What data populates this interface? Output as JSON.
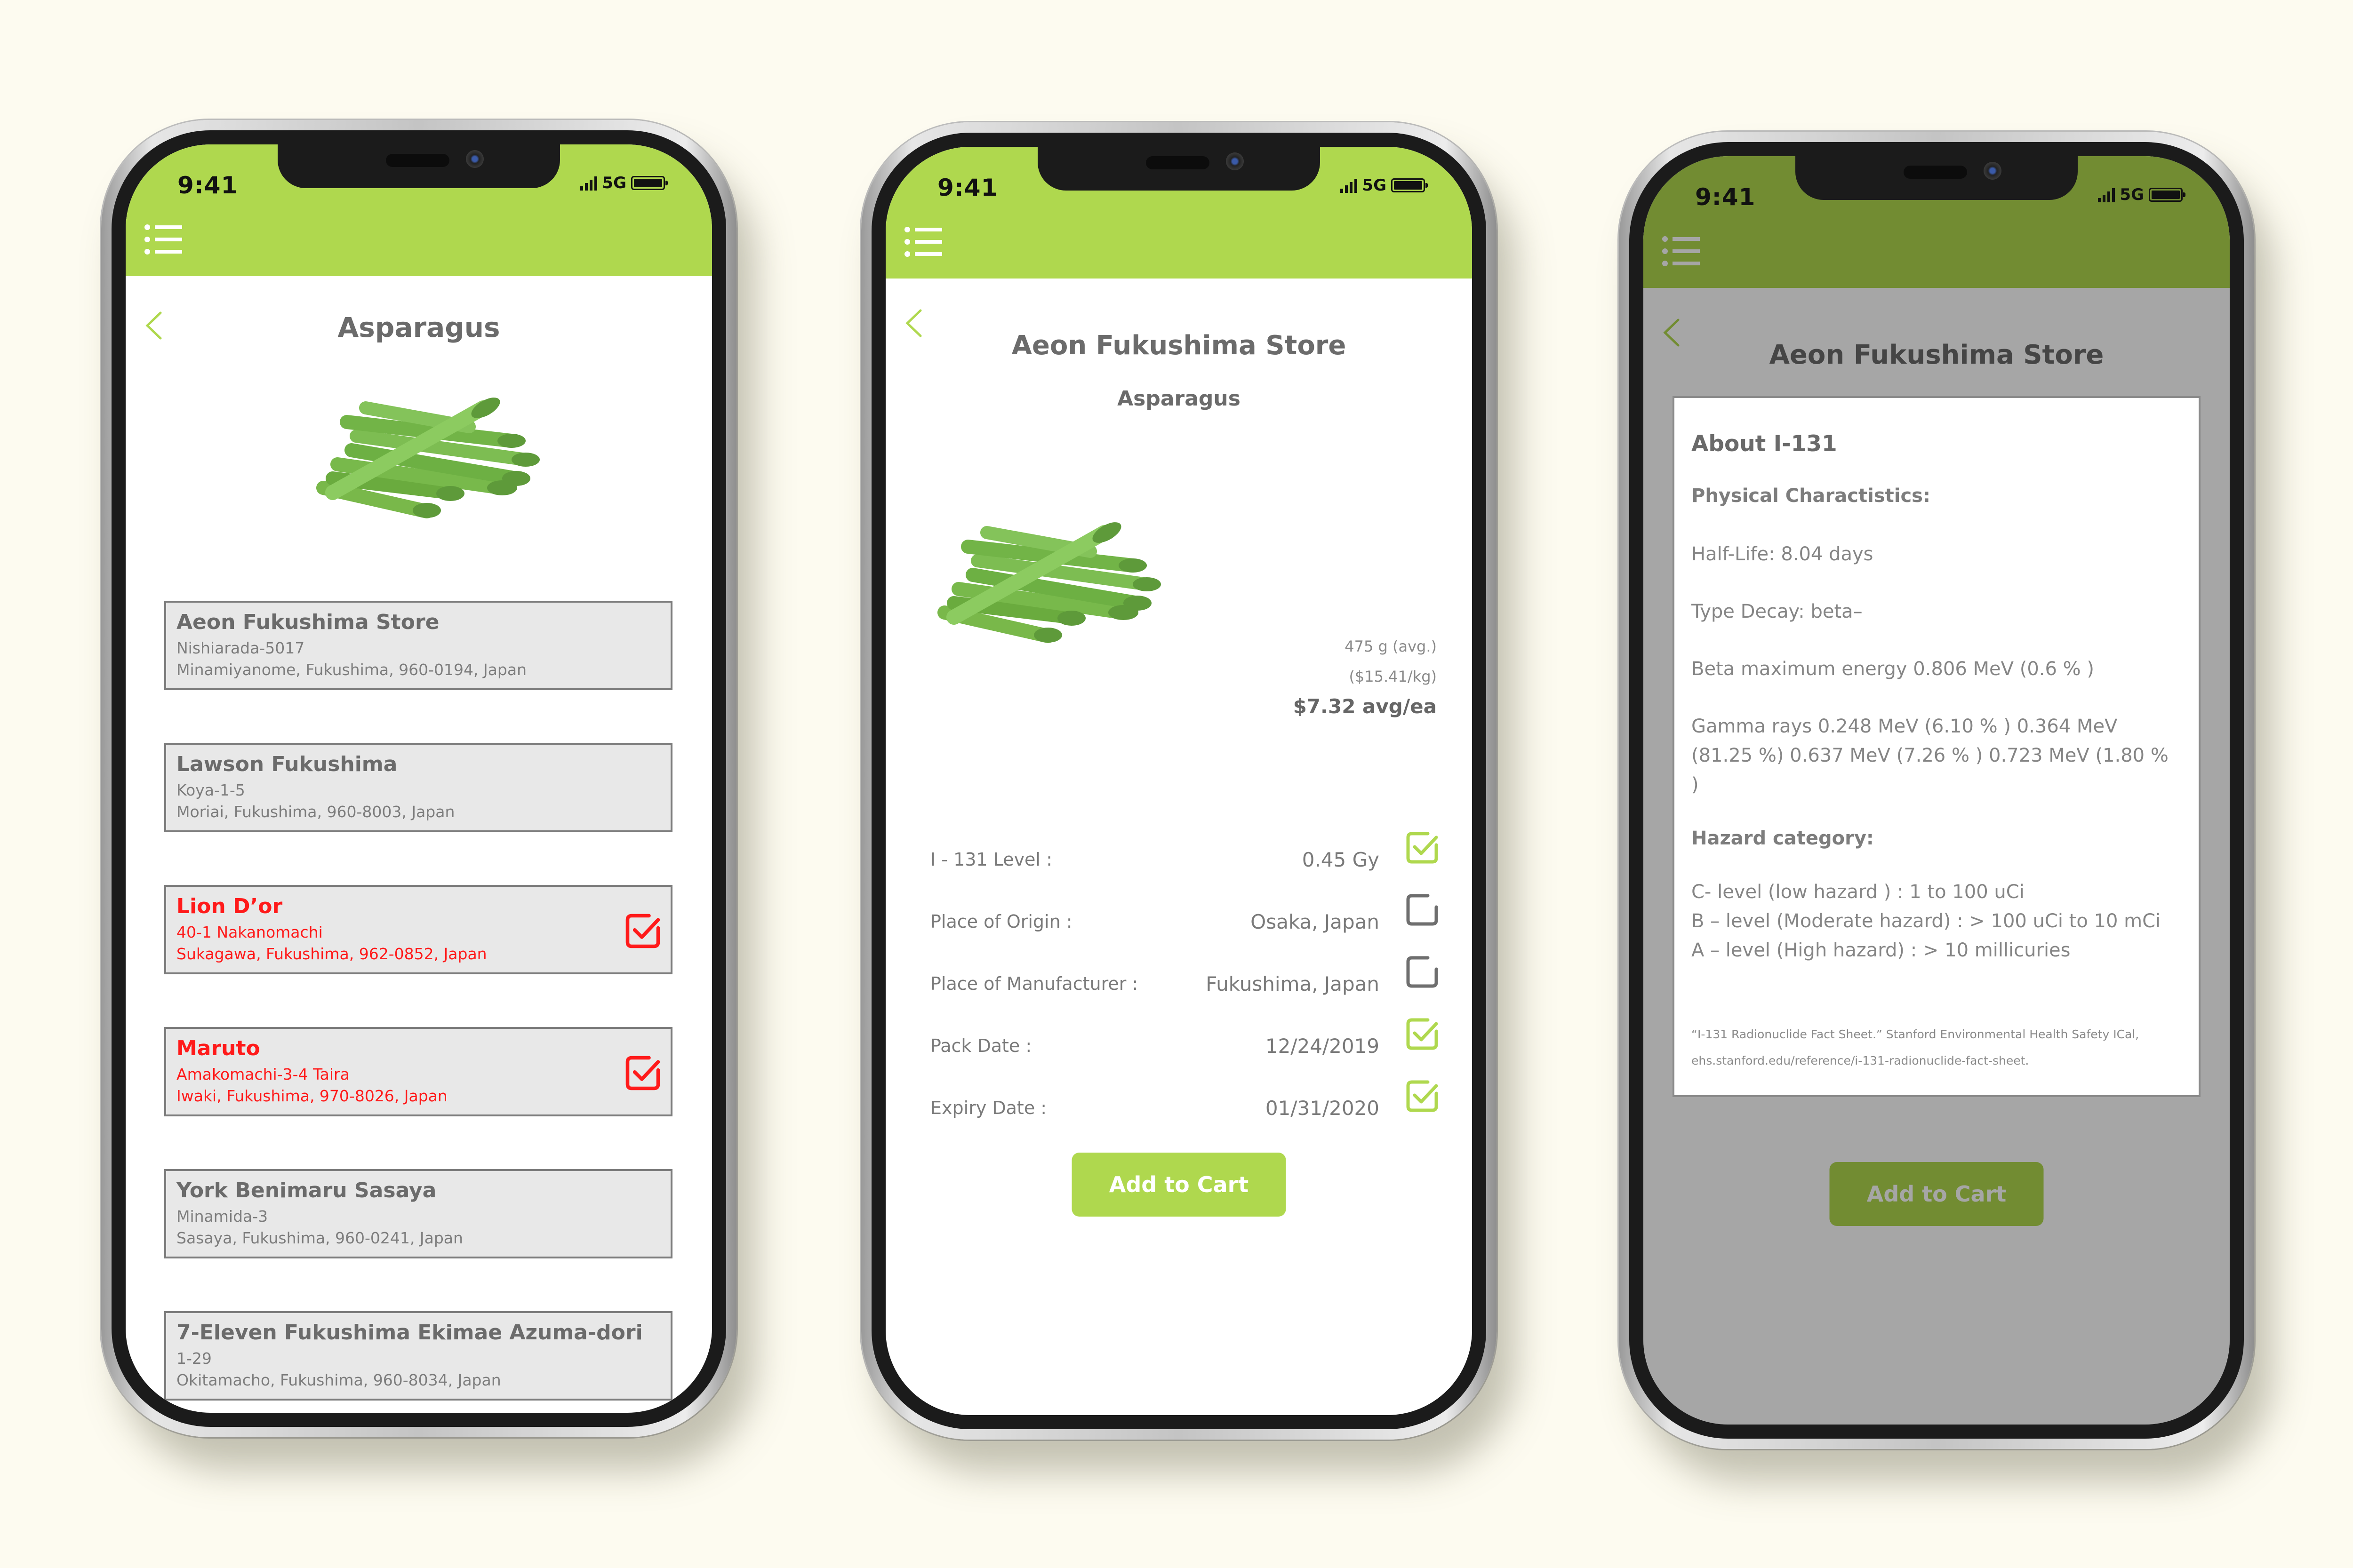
{
  "theme": {
    "accent": "#afd84e",
    "accent_dimmed": "#7f904f",
    "selected_red": "#ff1a1a",
    "text_gray": "#6b6b6b",
    "background": "#fdfbf0"
  },
  "status_bar": {
    "time": "9:41",
    "network": "5G"
  },
  "screen1": {
    "title": "Asparagus",
    "stores": [
      {
        "name": "Aeon Fukushima Store",
        "addr1": "Nishiarada-5017",
        "addr2": "Minamiyanome, Fukushima, 960-0194, Japan",
        "selected": false
      },
      {
        "name": "Lawson Fukushima",
        "addr1": "Koya-1-5",
        "addr2": "Moriai, Fukushima, 960-8003, Japan",
        "selected": false
      },
      {
        "name": "Lion D’or",
        "addr1": "40-1 Nakanomachi",
        "addr2": "Sukagawa, Fukushima, 962-0852, Japan",
        "selected": true
      },
      {
        "name": "Maruto",
        "addr1": "Amakomachi-3-4 Taira",
        "addr2": "Iwaki, Fukushima, 970-8026, Japan",
        "selected": true
      },
      {
        "name": "York Benimaru Sasaya",
        "addr1": "Minamida-3",
        "addr2": "Sasaya, Fukushima, 960-0241, Japan",
        "selected": false
      },
      {
        "name": "7-Eleven Fukushima Ekimae Azuma-dori",
        "addr1": "1-29",
        "addr2": "Okitamacho, Fukushima, 960-8034, Japan",
        "selected": false
      }
    ]
  },
  "screen2": {
    "title": "Aeon Fukushima Store",
    "subtitle": "Asparagus",
    "price": {
      "weight": "475 g (avg.)",
      "per_kg": "($15.41/kg)",
      "each": "$7.32 avg/ea"
    },
    "details": [
      {
        "label": "I - 131 Level :",
        "value": "0.45 Gy",
        "checked": true
      },
      {
        "label": "Place of Origin :",
        "value": "Osaka, Japan",
        "checked": false
      },
      {
        "label": "Place of Manufacturer :",
        "value": "Fukushima, Japan",
        "checked": false
      },
      {
        "label": "Pack Date :",
        "value": "12/24/2019",
        "checked": true
      },
      {
        "label": "Expiry Date :",
        "value": "01/31/2020",
        "checked": true
      }
    ],
    "add_to_cart": "Add to Cart"
  },
  "screen3": {
    "title": "Aeon Fukushima Store",
    "modal": {
      "title": "About I-131",
      "physical_heading": "Physical Charactistics:",
      "half_life": "Half-Life: 8.04 days",
      "decay": "Type Decay: beta–",
      "beta": "Beta maximum energy 0.806 MeV (0.6 % )",
      "gamma": "Gamma rays 0.248 MeV (6.10 % ) 0.364 MeV (81.25 %) 0.637 MeV (7.26 % ) 0.723 MeV (1.80 % )",
      "hazard_heading": "Hazard category:",
      "hazard_levels": [
        "C- level (low hazard ) : 1 to 100 uCi",
        "B – level (Moderate hazard) : > 100 uCi to 10 mCi",
        "A – level (High hazard) : > 10 millicuries"
      ],
      "citation_1": "“I-131 Radionuclide Fact Sheet.” Stanford Environmental Health Safety ICal,",
      "citation_2": "ehs.stanford.edu/reference/i-131-radionuclide-fact-sheet."
    },
    "add_to_cart": "Add to Cart"
  }
}
